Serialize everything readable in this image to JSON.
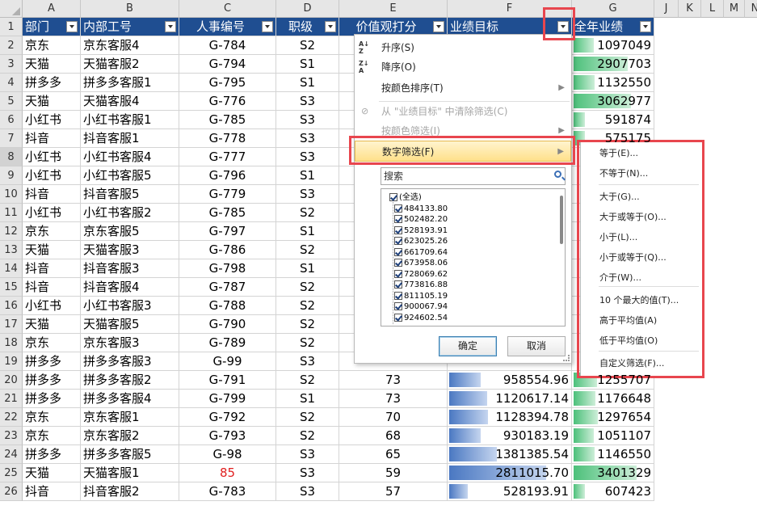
{
  "columns": {
    "row_header_letters": [
      "A",
      "B",
      "C",
      "D",
      "E",
      "F",
      "G",
      "J",
      "K",
      "L",
      "M",
      "N"
    ]
  },
  "headers": [
    "部门",
    "内部工号",
    "人事编号",
    "职级",
    "价值观打分",
    "业绩目标",
    "全年业绩"
  ],
  "rows": [
    {
      "dept": "京东",
      "id": "京东客服4",
      "emp": "G-784",
      "lvl": "S2",
      "score": "",
      "target": "",
      "annual": "1097049"
    },
    {
      "dept": "天猫",
      "id": "天猫客服2",
      "emp": "G-794",
      "lvl": "S1",
      "score": "",
      "target": "",
      "annual": "2907703"
    },
    {
      "dept": "拼多多",
      "id": "拼多多客服1",
      "emp": "G-795",
      "lvl": "S1",
      "score": "",
      "target": "",
      "annual": "1132550"
    },
    {
      "dept": "天猫",
      "id": "天猫客服4",
      "emp": "G-776",
      "lvl": "S3",
      "score": "",
      "target": "",
      "annual": "3062977"
    },
    {
      "dept": "小红书",
      "id": "小红书客服1",
      "emp": "G-785",
      "lvl": "S3",
      "score": "",
      "target": "",
      "annual": "591874"
    },
    {
      "dept": "抖音",
      "id": "抖音客服1",
      "emp": "G-778",
      "lvl": "S3",
      "score": "",
      "target": "",
      "annual": "575175"
    },
    {
      "dept": "小红书",
      "id": "小红书客服4",
      "emp": "G-777",
      "lvl": "S3",
      "score": "",
      "target": "",
      "annual": ""
    },
    {
      "dept": "小红书",
      "id": "小红书客服5",
      "emp": "G-796",
      "lvl": "S1",
      "score": "",
      "target": "",
      "annual": ""
    },
    {
      "dept": "抖音",
      "id": "抖音客服5",
      "emp": "G-779",
      "lvl": "S3",
      "score": "",
      "target": "",
      "annual": ""
    },
    {
      "dept": "小红书",
      "id": "小红书客服2",
      "emp": "G-785",
      "lvl": "S2",
      "score": "",
      "target": "",
      "annual": ""
    },
    {
      "dept": "京东",
      "id": "京东客服5",
      "emp": "G-797",
      "lvl": "S1",
      "score": "",
      "target": "",
      "annual": ""
    },
    {
      "dept": "天猫",
      "id": "天猫客服3",
      "emp": "G-786",
      "lvl": "S2",
      "score": "",
      "target": "",
      "annual": ""
    },
    {
      "dept": "抖音",
      "id": "抖音客服3",
      "emp": "G-798",
      "lvl": "S1",
      "score": "",
      "target": "",
      "annual": ""
    },
    {
      "dept": "抖音",
      "id": "抖音客服4",
      "emp": "G-787",
      "lvl": "S2",
      "score": "",
      "target": "",
      "annual": ""
    },
    {
      "dept": "小红书",
      "id": "小红书客服3",
      "emp": "G-788",
      "lvl": "S2",
      "score": "",
      "target": "",
      "annual": ""
    },
    {
      "dept": "天猫",
      "id": "天猫客服5",
      "emp": "G-790",
      "lvl": "S2",
      "score": "",
      "target": "",
      "annual": ""
    },
    {
      "dept": "京东",
      "id": "京东客服3",
      "emp": "G-789",
      "lvl": "S2",
      "score": "",
      "target": "",
      "annual": ""
    },
    {
      "dept": "拼多多",
      "id": "拼多多客服3",
      "emp": "G-99",
      "lvl": "S3",
      "score": "",
      "target": "",
      "annual": ""
    },
    {
      "dept": "拼多多",
      "id": "拼多多客服2",
      "emp": "G-791",
      "lvl": "S2",
      "score": "73",
      "target": "958554.96",
      "annual": "1255707"
    },
    {
      "dept": "拼多多",
      "id": "拼多多客服4",
      "emp": "G-799",
      "lvl": "S1",
      "score": "73",
      "target": "1120617.14",
      "annual": "1176648"
    },
    {
      "dept": "京东",
      "id": "京东客服1",
      "emp": "G-792",
      "lvl": "S2",
      "score": "70",
      "target": "1128394.78",
      "annual": "1297654"
    },
    {
      "dept": "京东",
      "id": "京东客服2",
      "emp": "G-793",
      "lvl": "S2",
      "score": "68",
      "target": "930183.19",
      "annual": "1051107"
    },
    {
      "dept": "拼多多",
      "id": "拼多多客服5",
      "emp": "G-98",
      "lvl": "S3",
      "score": "65",
      "target": "1381385.54",
      "annual": "1146550"
    },
    {
      "dept": "天猫",
      "id": "天猫客服1",
      "emp": "85",
      "lvl": "S3",
      "score": "59",
      "target": "2811015.70",
      "annual": "3401329"
    },
    {
      "dept": "抖音",
      "id": "抖音客服2",
      "emp": "G-783",
      "lvl": "S3",
      "score": "57",
      "target": "528193.91",
      "annual": "607423"
    }
  ],
  "target_bar_fraction": [
    0,
    0,
    0,
    0,
    0,
    0,
    0,
    0,
    0,
    0,
    0,
    0,
    0,
    0,
    0,
    0,
    0,
    0,
    0.26,
    0.31,
    0.32,
    0.26,
    0.39,
    0.8,
    0.15
  ],
  "annual_bar_fraction": [
    0.26,
    0.68,
    0.27,
    0.72,
    0.14,
    0.14,
    0,
    0,
    0,
    0,
    0,
    0,
    0,
    0,
    0,
    0,
    0,
    0,
    0.3,
    0.28,
    0.31,
    0.25,
    0.27,
    0.8,
    0.14
  ],
  "filter_menu": {
    "sort_asc": "升序(S)",
    "sort_desc": "降序(O)",
    "sort_by_color": "按颜色排序(T)",
    "clear_filter": "从 \"业绩目标\" 中清除筛选(C)",
    "filter_by_color": "按颜色筛选(I)",
    "number_filter": "数字筛选(F)",
    "search_placeholder": "搜索",
    "list_items": [
      "(全选)",
      "484133.80",
      "502482.20",
      "528193.91",
      "623025.26",
      "661709.64",
      "673958.06",
      "728069.62",
      "773816.88",
      "811105.19",
      "900067.94",
      "924602.54"
    ],
    "ok": "确定",
    "cancel": "取消"
  },
  "number_filter_submenu": [
    "等于(E)...",
    "不等于(N)...",
    "大于(G)...",
    "大于或等于(O)...",
    "小于(L)...",
    "小于或等于(Q)...",
    "介于(W)...",
    "10 个最大的值(T)...",
    "高于平均值(A)",
    "低于平均值(O)",
    "自定义筛选(F)..."
  ],
  "colors": {
    "header_bg": "#1f4e91",
    "highlight": "#e8464e",
    "target_bar": "#4a78c2",
    "annual_bar": "#4cc07a"
  }
}
